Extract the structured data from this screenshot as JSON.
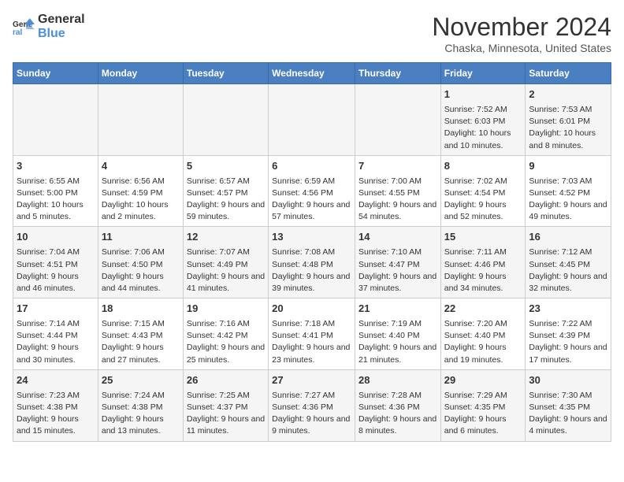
{
  "header": {
    "logo_line1": "General",
    "logo_line2": "Blue",
    "month_title": "November 2024",
    "location": "Chaska, Minnesota, United States"
  },
  "columns": [
    "Sunday",
    "Monday",
    "Tuesday",
    "Wednesday",
    "Thursday",
    "Friday",
    "Saturday"
  ],
  "weeks": [
    [
      {
        "day": "",
        "info": ""
      },
      {
        "day": "",
        "info": ""
      },
      {
        "day": "",
        "info": ""
      },
      {
        "day": "",
        "info": ""
      },
      {
        "day": "",
        "info": ""
      },
      {
        "day": "1",
        "info": "Sunrise: 7:52 AM\nSunset: 6:03 PM\nDaylight: 10 hours and 10 minutes."
      },
      {
        "day": "2",
        "info": "Sunrise: 7:53 AM\nSunset: 6:01 PM\nDaylight: 10 hours and 8 minutes."
      }
    ],
    [
      {
        "day": "3",
        "info": "Sunrise: 6:55 AM\nSunset: 5:00 PM\nDaylight: 10 hours and 5 minutes."
      },
      {
        "day": "4",
        "info": "Sunrise: 6:56 AM\nSunset: 4:59 PM\nDaylight: 10 hours and 2 minutes."
      },
      {
        "day": "5",
        "info": "Sunrise: 6:57 AM\nSunset: 4:57 PM\nDaylight: 9 hours and 59 minutes."
      },
      {
        "day": "6",
        "info": "Sunrise: 6:59 AM\nSunset: 4:56 PM\nDaylight: 9 hours and 57 minutes."
      },
      {
        "day": "7",
        "info": "Sunrise: 7:00 AM\nSunset: 4:55 PM\nDaylight: 9 hours and 54 minutes."
      },
      {
        "day": "8",
        "info": "Sunrise: 7:02 AM\nSunset: 4:54 PM\nDaylight: 9 hours and 52 minutes."
      },
      {
        "day": "9",
        "info": "Sunrise: 7:03 AM\nSunset: 4:52 PM\nDaylight: 9 hours and 49 minutes."
      }
    ],
    [
      {
        "day": "10",
        "info": "Sunrise: 7:04 AM\nSunset: 4:51 PM\nDaylight: 9 hours and 46 minutes."
      },
      {
        "day": "11",
        "info": "Sunrise: 7:06 AM\nSunset: 4:50 PM\nDaylight: 9 hours and 44 minutes."
      },
      {
        "day": "12",
        "info": "Sunrise: 7:07 AM\nSunset: 4:49 PM\nDaylight: 9 hours and 41 minutes."
      },
      {
        "day": "13",
        "info": "Sunrise: 7:08 AM\nSunset: 4:48 PM\nDaylight: 9 hours and 39 minutes."
      },
      {
        "day": "14",
        "info": "Sunrise: 7:10 AM\nSunset: 4:47 PM\nDaylight: 9 hours and 37 minutes."
      },
      {
        "day": "15",
        "info": "Sunrise: 7:11 AM\nSunset: 4:46 PM\nDaylight: 9 hours and 34 minutes."
      },
      {
        "day": "16",
        "info": "Sunrise: 7:12 AM\nSunset: 4:45 PM\nDaylight: 9 hours and 32 minutes."
      }
    ],
    [
      {
        "day": "17",
        "info": "Sunrise: 7:14 AM\nSunset: 4:44 PM\nDaylight: 9 hours and 30 minutes."
      },
      {
        "day": "18",
        "info": "Sunrise: 7:15 AM\nSunset: 4:43 PM\nDaylight: 9 hours and 27 minutes."
      },
      {
        "day": "19",
        "info": "Sunrise: 7:16 AM\nSunset: 4:42 PM\nDaylight: 9 hours and 25 minutes."
      },
      {
        "day": "20",
        "info": "Sunrise: 7:18 AM\nSunset: 4:41 PM\nDaylight: 9 hours and 23 minutes."
      },
      {
        "day": "21",
        "info": "Sunrise: 7:19 AM\nSunset: 4:40 PM\nDaylight: 9 hours and 21 minutes."
      },
      {
        "day": "22",
        "info": "Sunrise: 7:20 AM\nSunset: 4:40 PM\nDaylight: 9 hours and 19 minutes."
      },
      {
        "day": "23",
        "info": "Sunrise: 7:22 AM\nSunset: 4:39 PM\nDaylight: 9 hours and 17 minutes."
      }
    ],
    [
      {
        "day": "24",
        "info": "Sunrise: 7:23 AM\nSunset: 4:38 PM\nDaylight: 9 hours and 15 minutes."
      },
      {
        "day": "25",
        "info": "Sunrise: 7:24 AM\nSunset: 4:38 PM\nDaylight: 9 hours and 13 minutes."
      },
      {
        "day": "26",
        "info": "Sunrise: 7:25 AM\nSunset: 4:37 PM\nDaylight: 9 hours and 11 minutes."
      },
      {
        "day": "27",
        "info": "Sunrise: 7:27 AM\nSunset: 4:36 PM\nDaylight: 9 hours and 9 minutes."
      },
      {
        "day": "28",
        "info": "Sunrise: 7:28 AM\nSunset: 4:36 PM\nDaylight: 9 hours and 8 minutes."
      },
      {
        "day": "29",
        "info": "Sunrise: 7:29 AM\nSunset: 4:35 PM\nDaylight: 9 hours and 6 minutes."
      },
      {
        "day": "30",
        "info": "Sunrise: 7:30 AM\nSunset: 4:35 PM\nDaylight: 9 hours and 4 minutes."
      }
    ]
  ]
}
